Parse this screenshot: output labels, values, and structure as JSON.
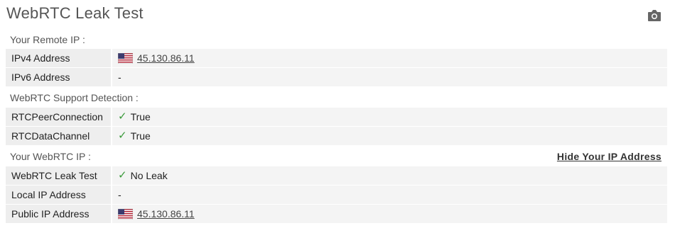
{
  "title": "WebRTC Leak Test",
  "camera_icon": "camera-icon",
  "sections": {
    "remote": {
      "heading": "Your Remote IP :",
      "ipv4_label": "IPv4 Address",
      "ipv4_value": "45.130.86.11",
      "ipv4_flag": "us-flag-icon",
      "ipv6_label": "IPv6 Address",
      "ipv6_value": "-"
    },
    "support": {
      "heading": "WebRTC Support Detection :",
      "peer_label": "RTCPeerConnection",
      "peer_value": "True",
      "channel_label": "RTCDataChannel",
      "channel_value": "True"
    },
    "webrtc": {
      "heading": "Your WebRTC IP :",
      "hide_link": "Hide Your IP Address",
      "leak_label": "WebRTC Leak Test",
      "leak_value": "No Leak",
      "local_label": "Local IP Address",
      "local_value": "-",
      "public_label": "Public IP Address",
      "public_value": "45.130.86.11",
      "public_flag": "us-flag-icon"
    }
  },
  "check_glyph": "✓",
  "colors": {
    "check": "#3a9a3a",
    "title": "#555555"
  }
}
